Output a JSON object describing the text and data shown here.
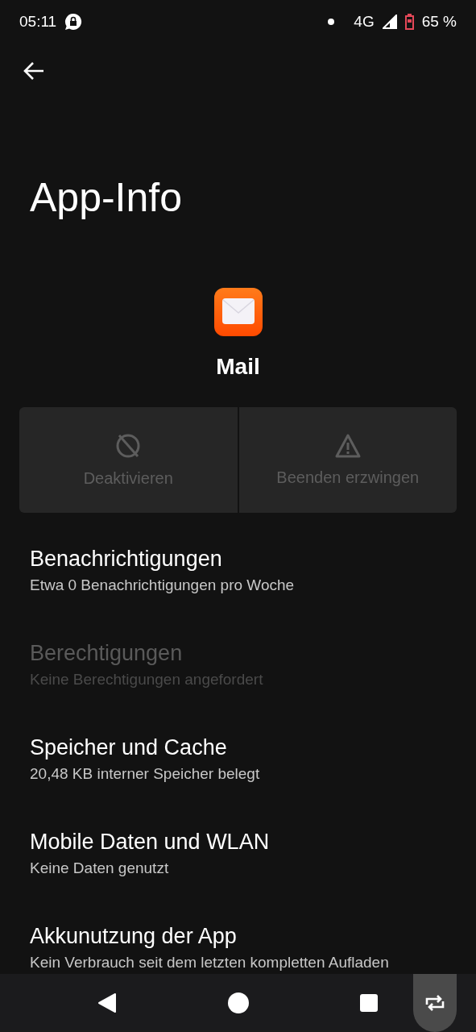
{
  "status_bar": {
    "time": "05:11",
    "network": "4G",
    "battery": "65 %"
  },
  "title": "App-Info",
  "app": {
    "name": "Mail"
  },
  "actions": [
    {
      "kind": "disable",
      "label": "Deaktivieren",
      "disabled": true
    },
    {
      "kind": "force_stop",
      "label": "Beenden erzwingen",
      "disabled": true
    }
  ],
  "settings": [
    {
      "title": "Benachrichtigungen",
      "subtitle": "Etwa 0 Benachrichtigungen pro Woche",
      "disabled": false
    },
    {
      "title": "Berechtigungen",
      "subtitle": "Keine Berechtigungen angefordert",
      "disabled": true
    },
    {
      "title": "Speicher und Cache",
      "subtitle": "20,48 KB interner Speicher belegt",
      "disabled": false
    },
    {
      "title": "Mobile Daten und WLAN",
      "subtitle": "Keine Daten genutzt",
      "disabled": false
    },
    {
      "title": "Akkunutzung der App",
      "subtitle": "Kein Verbrauch seit dem letzten kompletten Aufladen",
      "disabled": false
    }
  ]
}
